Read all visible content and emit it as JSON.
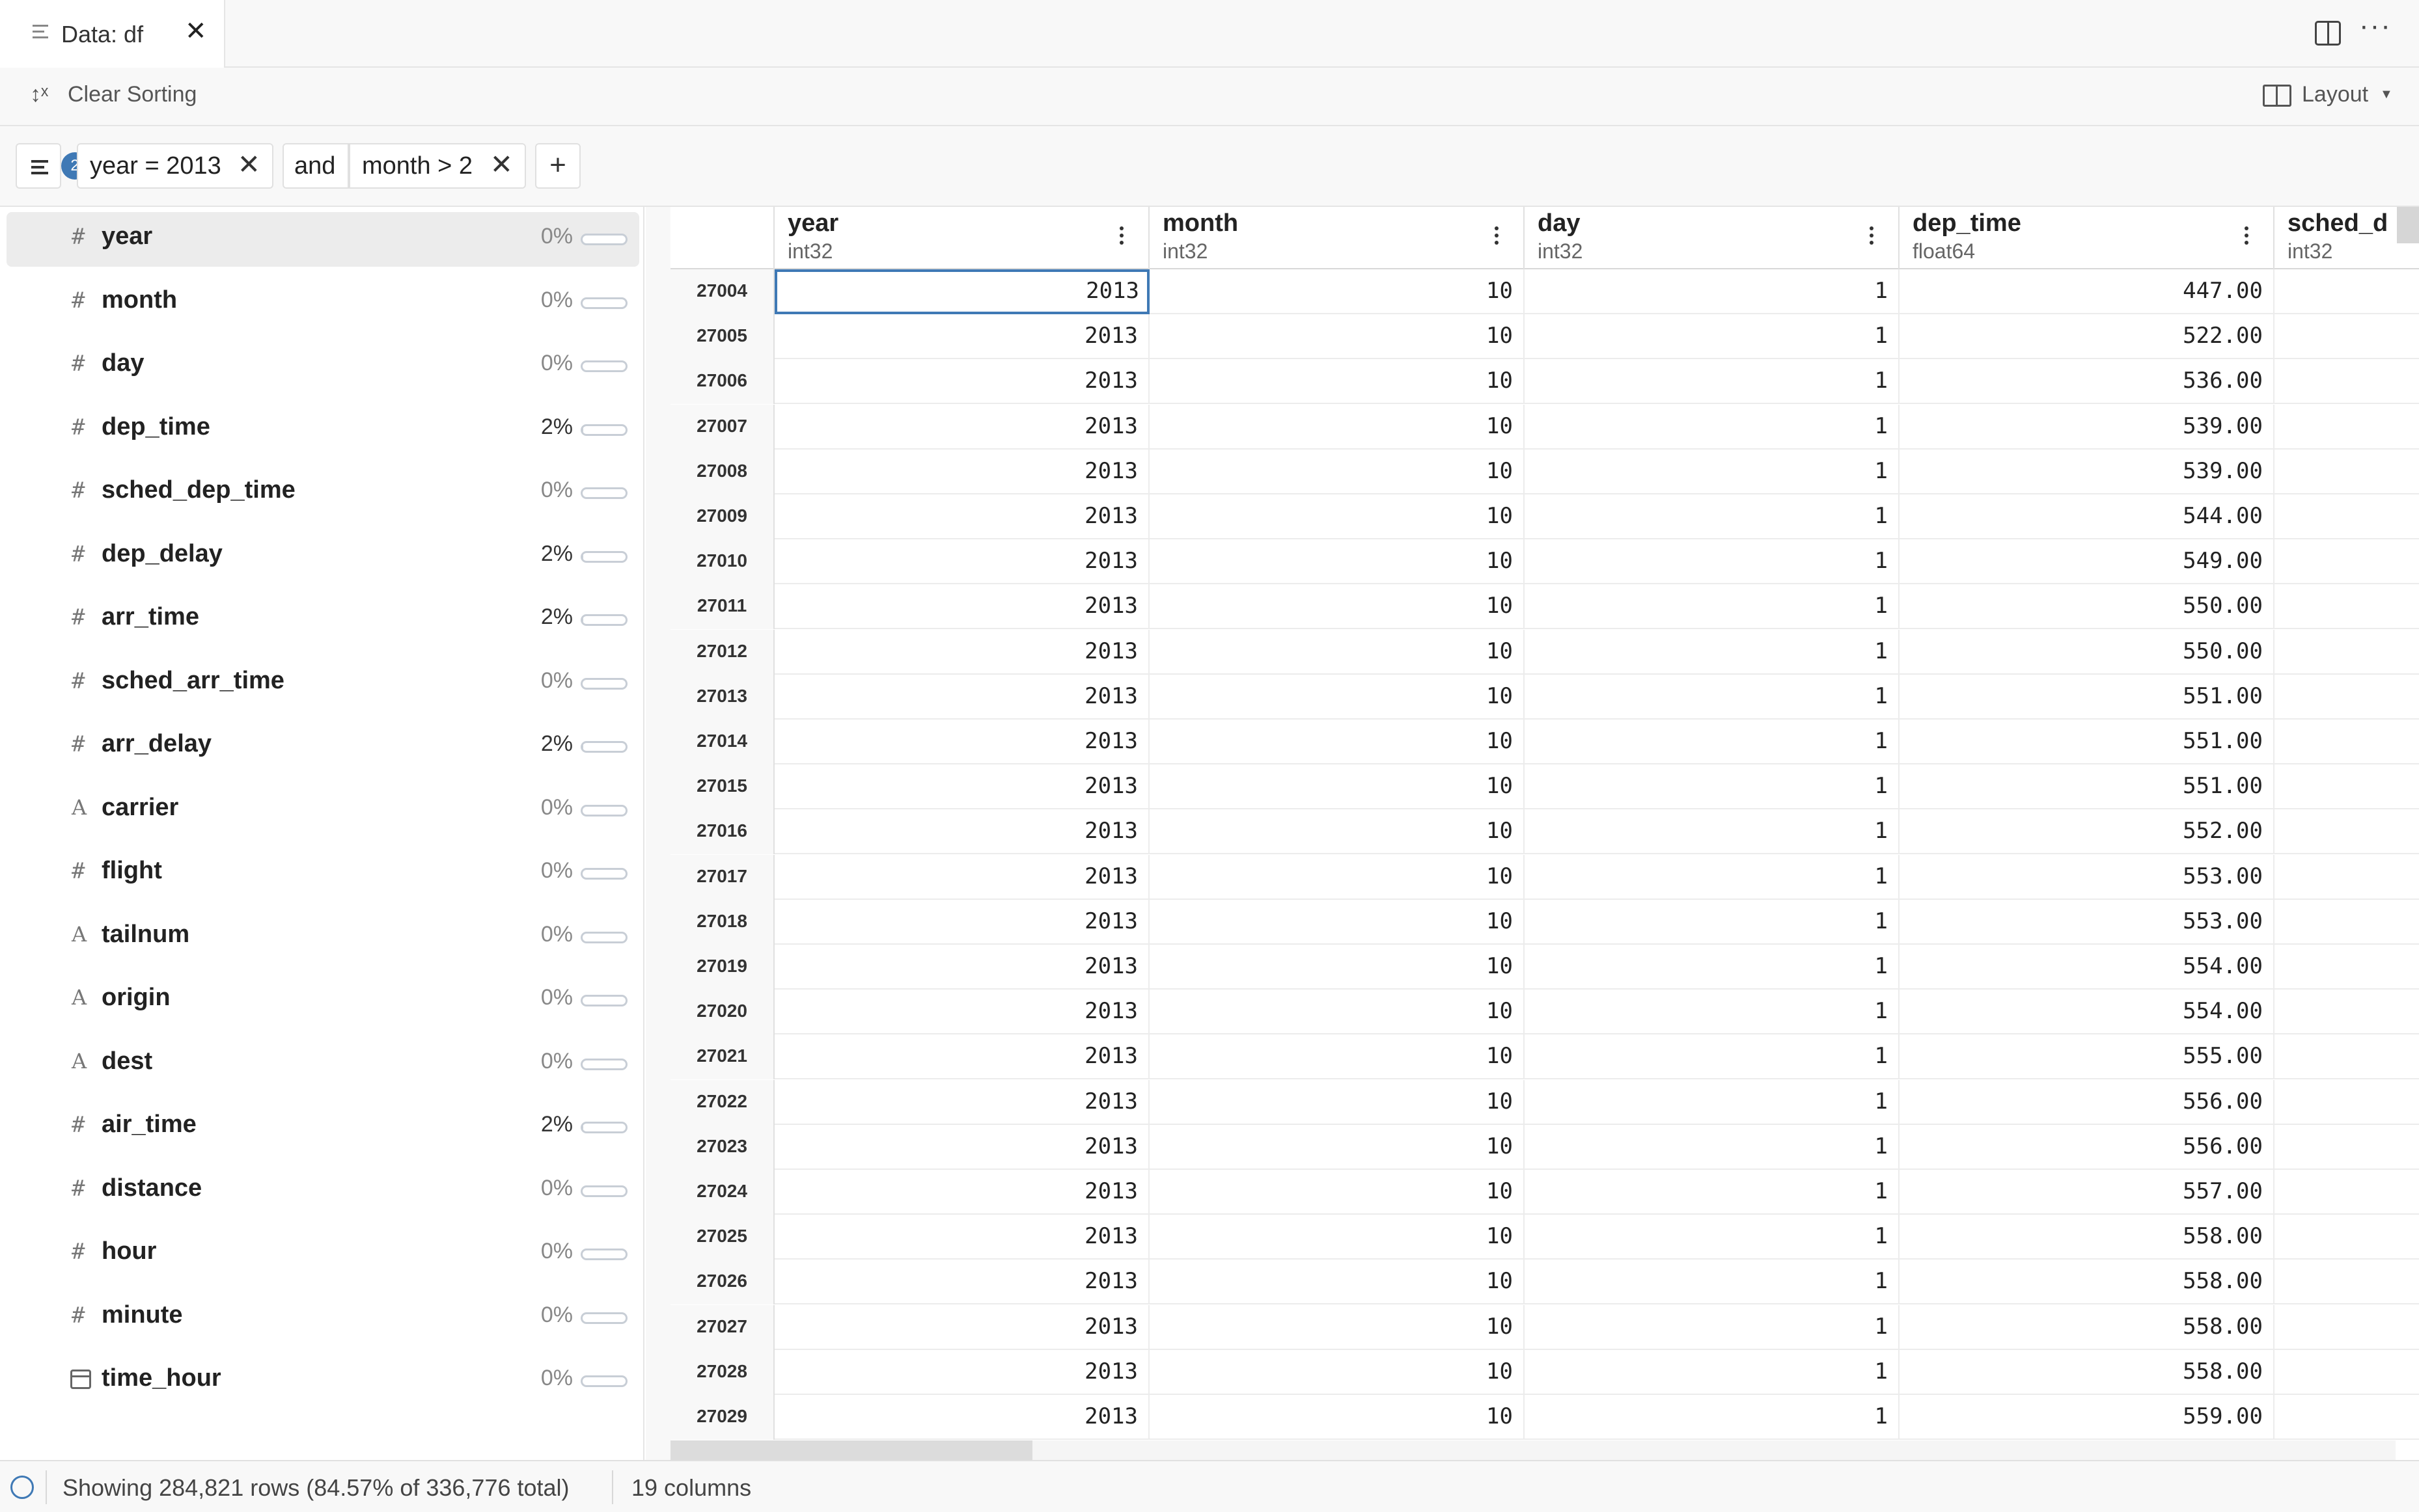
{
  "tab": {
    "label": "Data: df",
    "close": "✕"
  },
  "toolbar": {
    "clear_sorting_label": "Clear Sorting",
    "layout_label": "Layout"
  },
  "filters": {
    "count": "2",
    "chips": [
      {
        "label": "year = 2013"
      },
      {
        "label": "month > 2"
      }
    ],
    "join_label": "and",
    "add_label": "+"
  },
  "columns": [
    {
      "name": "year",
      "kind": "number",
      "missing": "0%",
      "fill": 0
    },
    {
      "name": "month",
      "kind": "number",
      "missing": "0%",
      "fill": 0
    },
    {
      "name": "day",
      "kind": "number",
      "missing": "0%",
      "fill": 0
    },
    {
      "name": "dep_time",
      "kind": "number",
      "missing": "2%",
      "fill": 0.02
    },
    {
      "name": "sched_dep_time",
      "kind": "number",
      "missing": "0%",
      "fill": 0
    },
    {
      "name": "dep_delay",
      "kind": "number",
      "missing": "2%",
      "fill": 0.02
    },
    {
      "name": "arr_time",
      "kind": "number",
      "missing": "2%",
      "fill": 0.02
    },
    {
      "name": "sched_arr_time",
      "kind": "number",
      "missing": "0%",
      "fill": 0
    },
    {
      "name": "arr_delay",
      "kind": "number",
      "missing": "2%",
      "fill": 0.02
    },
    {
      "name": "carrier",
      "kind": "string",
      "missing": "0%",
      "fill": 0
    },
    {
      "name": "flight",
      "kind": "number",
      "missing": "0%",
      "fill": 0
    },
    {
      "name": "tailnum",
      "kind": "string",
      "missing": "0%",
      "fill": 0
    },
    {
      "name": "origin",
      "kind": "string",
      "missing": "0%",
      "fill": 0
    },
    {
      "name": "dest",
      "kind": "string",
      "missing": "0%",
      "fill": 0
    },
    {
      "name": "air_time",
      "kind": "number",
      "missing": "2%",
      "fill": 0.02
    },
    {
      "name": "distance",
      "kind": "number",
      "missing": "0%",
      "fill": 0
    },
    {
      "name": "hour",
      "kind": "number",
      "missing": "0%",
      "fill": 0
    },
    {
      "name": "minute",
      "kind": "number",
      "missing": "0%",
      "fill": 0
    },
    {
      "name": "time_hour",
      "kind": "datetime",
      "missing": "0%",
      "fill": 0
    }
  ],
  "type_glyphs": {
    "number": "#",
    "string": "A"
  },
  "grid": {
    "headers": [
      {
        "name": "year",
        "type": "int32"
      },
      {
        "name": "month",
        "type": "int32"
      },
      {
        "name": "day",
        "type": "int32"
      },
      {
        "name": "dep_time",
        "type": "float64"
      },
      {
        "name": "sched_d",
        "type": "int32"
      }
    ],
    "rows": [
      {
        "index": "27004",
        "cells": [
          "2013",
          "10",
          "1",
          "447.00",
          ""
        ]
      },
      {
        "index": "27005",
        "cells": [
          "2013",
          "10",
          "1",
          "522.00",
          ""
        ]
      },
      {
        "index": "27006",
        "cells": [
          "2013",
          "10",
          "1",
          "536.00",
          ""
        ]
      },
      {
        "index": "27007",
        "cells": [
          "2013",
          "10",
          "1",
          "539.00",
          ""
        ]
      },
      {
        "index": "27008",
        "cells": [
          "2013",
          "10",
          "1",
          "539.00",
          ""
        ]
      },
      {
        "index": "27009",
        "cells": [
          "2013",
          "10",
          "1",
          "544.00",
          ""
        ]
      },
      {
        "index": "27010",
        "cells": [
          "2013",
          "10",
          "1",
          "549.00",
          ""
        ]
      },
      {
        "index": "27011",
        "cells": [
          "2013",
          "10",
          "1",
          "550.00",
          ""
        ]
      },
      {
        "index": "27012",
        "cells": [
          "2013",
          "10",
          "1",
          "550.00",
          ""
        ]
      },
      {
        "index": "27013",
        "cells": [
          "2013",
          "10",
          "1",
          "551.00",
          ""
        ]
      },
      {
        "index": "27014",
        "cells": [
          "2013",
          "10",
          "1",
          "551.00",
          ""
        ]
      },
      {
        "index": "27015",
        "cells": [
          "2013",
          "10",
          "1",
          "551.00",
          ""
        ]
      },
      {
        "index": "27016",
        "cells": [
          "2013",
          "10",
          "1",
          "552.00",
          ""
        ]
      },
      {
        "index": "27017",
        "cells": [
          "2013",
          "10",
          "1",
          "553.00",
          ""
        ]
      },
      {
        "index": "27018",
        "cells": [
          "2013",
          "10",
          "1",
          "553.00",
          ""
        ]
      },
      {
        "index": "27019",
        "cells": [
          "2013",
          "10",
          "1",
          "554.00",
          ""
        ]
      },
      {
        "index": "27020",
        "cells": [
          "2013",
          "10",
          "1",
          "554.00",
          ""
        ]
      },
      {
        "index": "27021",
        "cells": [
          "2013",
          "10",
          "1",
          "555.00",
          ""
        ]
      },
      {
        "index": "27022",
        "cells": [
          "2013",
          "10",
          "1",
          "556.00",
          ""
        ]
      },
      {
        "index": "27023",
        "cells": [
          "2013",
          "10",
          "1",
          "556.00",
          ""
        ]
      },
      {
        "index": "27024",
        "cells": [
          "2013",
          "10",
          "1",
          "557.00",
          ""
        ]
      },
      {
        "index": "27025",
        "cells": [
          "2013",
          "10",
          "1",
          "558.00",
          ""
        ]
      },
      {
        "index": "27026",
        "cells": [
          "2013",
          "10",
          "1",
          "558.00",
          ""
        ]
      },
      {
        "index": "27027",
        "cells": [
          "2013",
          "10",
          "1",
          "558.00",
          ""
        ]
      },
      {
        "index": "27028",
        "cells": [
          "2013",
          "10",
          "1",
          "558.00",
          ""
        ]
      },
      {
        "index": "27029",
        "cells": [
          "2013",
          "10",
          "1",
          "559.00",
          ""
        ]
      }
    ]
  },
  "status": {
    "rows_text": "Showing 284,821 rows (84.57% of 336,776 total)",
    "columns_text": "19 columns"
  },
  "colors": {
    "accent": "#3f79b5",
    "selection": "#ececec"
  }
}
